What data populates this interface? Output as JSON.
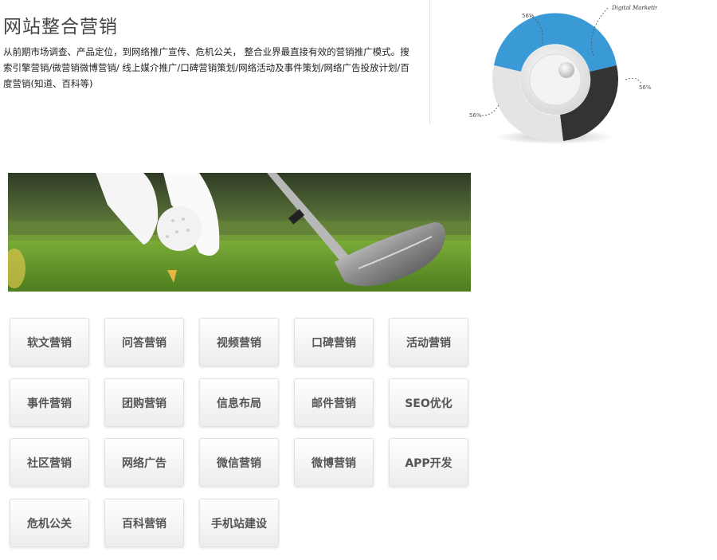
{
  "header": {
    "title": "网站整合营销",
    "description": "从前期市场调查、产品定位，到网络推广宣传、危机公关， 整合业界最直接有效的营销推广模式。搜索引擎营销/微营销微博营销/ 线上媒介推广/口碑营销策划/网络活动及事件策划/网络广告投放计划/百度营销(知道、百科等)"
  },
  "diagram": {
    "label_top_right": "Digital Marketing",
    "label_a": "56%",
    "label_b": "56%",
    "label_c": "56%",
    "colors": {
      "blue": "#3a9ad6",
      "dark": "#333333",
      "light": "#e4e4e4"
    }
  },
  "banner": {
    "alt": "golf"
  },
  "services": [
    "软文营销",
    "问答营销",
    "视频营销",
    "口碑营销",
    "活动营销",
    "事件营销",
    "团购营销",
    "信息布局",
    "邮件营销",
    "SEO优化",
    "社区营销",
    "网络广告",
    "微信营销",
    "微博营销",
    "APP开发",
    "危机公关",
    "百科营销",
    "手机站建设"
  ]
}
